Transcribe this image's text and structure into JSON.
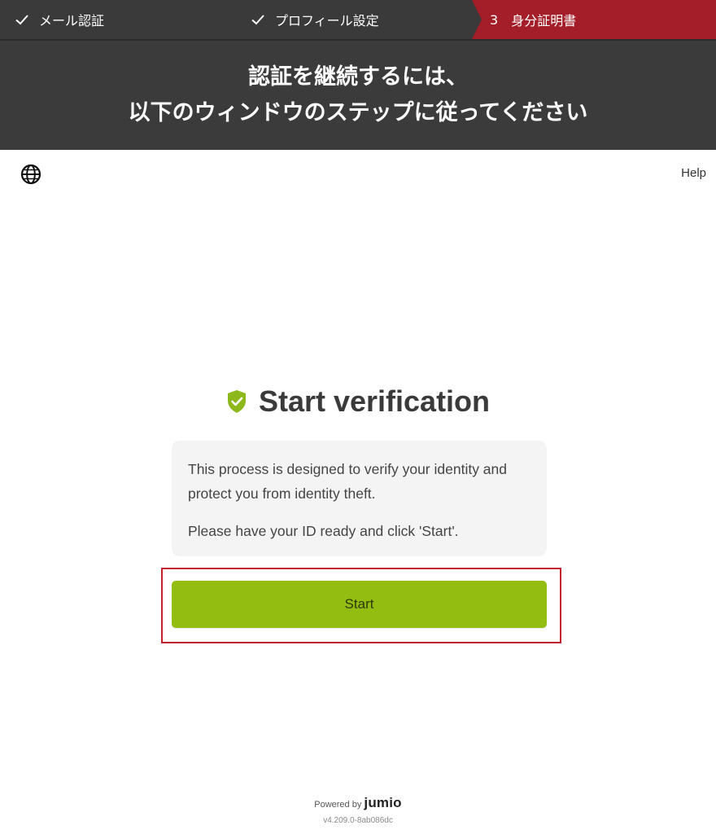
{
  "steps": [
    {
      "label": "メール認証",
      "status": "done"
    },
    {
      "label": "プロフィール設定",
      "status": "done"
    },
    {
      "number": "3",
      "label": "身分証明書",
      "status": "current"
    }
  ],
  "banner": {
    "line1": "認証を継続するには、",
    "line2": "以下のウィンドウのステップに従ってください"
  },
  "toolbar": {
    "language_icon": "globe-icon",
    "help_label": "Help"
  },
  "card": {
    "title": "Start verification",
    "title_icon": "shield-check-icon",
    "description_1": "This process is designed to verify your identity and protect you from identity theft.",
    "description_2": "Please have your ID ready and click 'Start'.",
    "start_label": "Start"
  },
  "footer": {
    "powered_by": "Powered by",
    "brand": "jumio",
    "version": "v4.209.0-8ab086dc"
  },
  "colors": {
    "step_bar": "#3a3a3a",
    "active_step": "#a31e28",
    "accent_green": "#94bd12",
    "highlight_outline": "#c4202d"
  }
}
